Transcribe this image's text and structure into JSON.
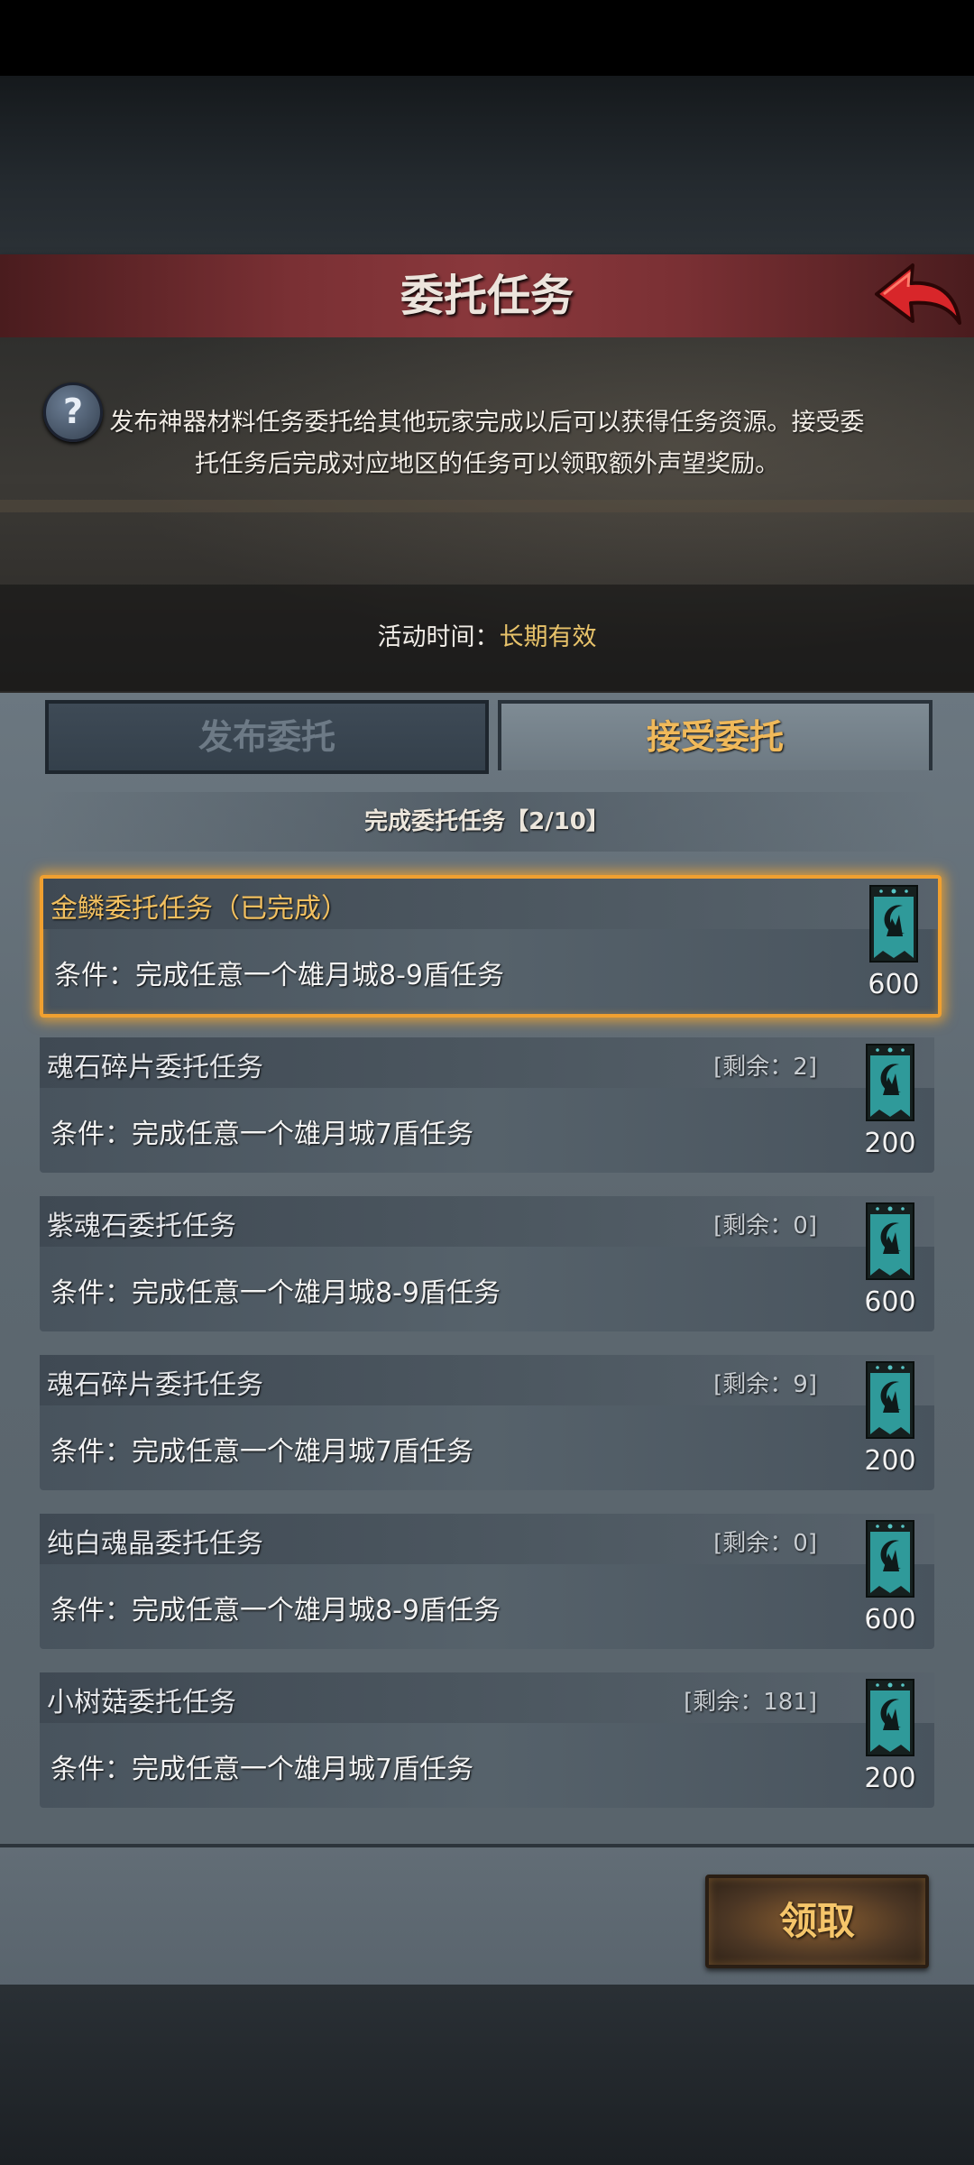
{
  "header": {
    "title": "委托任务",
    "back_icon": "back-arrow-icon"
  },
  "banner": {
    "help_icon": "question-icon",
    "help_glyph": "?",
    "description": "发布神器材料任务委托给其他玩家完成以后可以获得任务资源。接受委托任务后完成对应地区的任务可以领取额外声望奖励。",
    "time_label": "活动时间：",
    "time_value": "长期有效"
  },
  "tabs": [
    {
      "label": "发布委托",
      "active": false
    },
    {
      "label": "接受委托",
      "active": true
    }
  ],
  "progress_text": "完成委托任务【2/10】",
  "tasks": [
    {
      "name": "金鳞委托任务（已完成）",
      "remaining": "",
      "condition": "条件：完成任意一个雄月城8-9盾任务",
      "reward": "600",
      "completed": true
    },
    {
      "name": "魂石碎片委托任务",
      "remaining": "[剩余：2]",
      "condition": "条件：完成任意一个雄月城7盾任务",
      "reward": "200",
      "completed": false
    },
    {
      "name": "紫魂石委托任务",
      "remaining": "[剩余：0]",
      "condition": "条件：完成任意一个雄月城8-9盾任务",
      "reward": "600",
      "completed": false
    },
    {
      "name": "魂石碎片委托任务",
      "remaining": "[剩余：9]",
      "condition": "条件：完成任意一个雄月城7盾任务",
      "reward": "200",
      "completed": false
    },
    {
      "name": "纯白魂晶委托任务",
      "remaining": "[剩余：0]",
      "condition": "条件：完成任意一个雄月城8-9盾任务",
      "reward": "600",
      "completed": false
    },
    {
      "name": "小树菇委托任务",
      "remaining": "[剩余：181]",
      "condition": "条件：完成任意一个雄月城7盾任务",
      "reward": "200",
      "completed": false
    }
  ],
  "reward_icon": "banner-emblem-icon",
  "claim_button": "领取",
  "colors": {
    "accent_gold": "#f0b95a",
    "title_red": "#8a383c",
    "emblem_teal": "#2f9a9a"
  }
}
